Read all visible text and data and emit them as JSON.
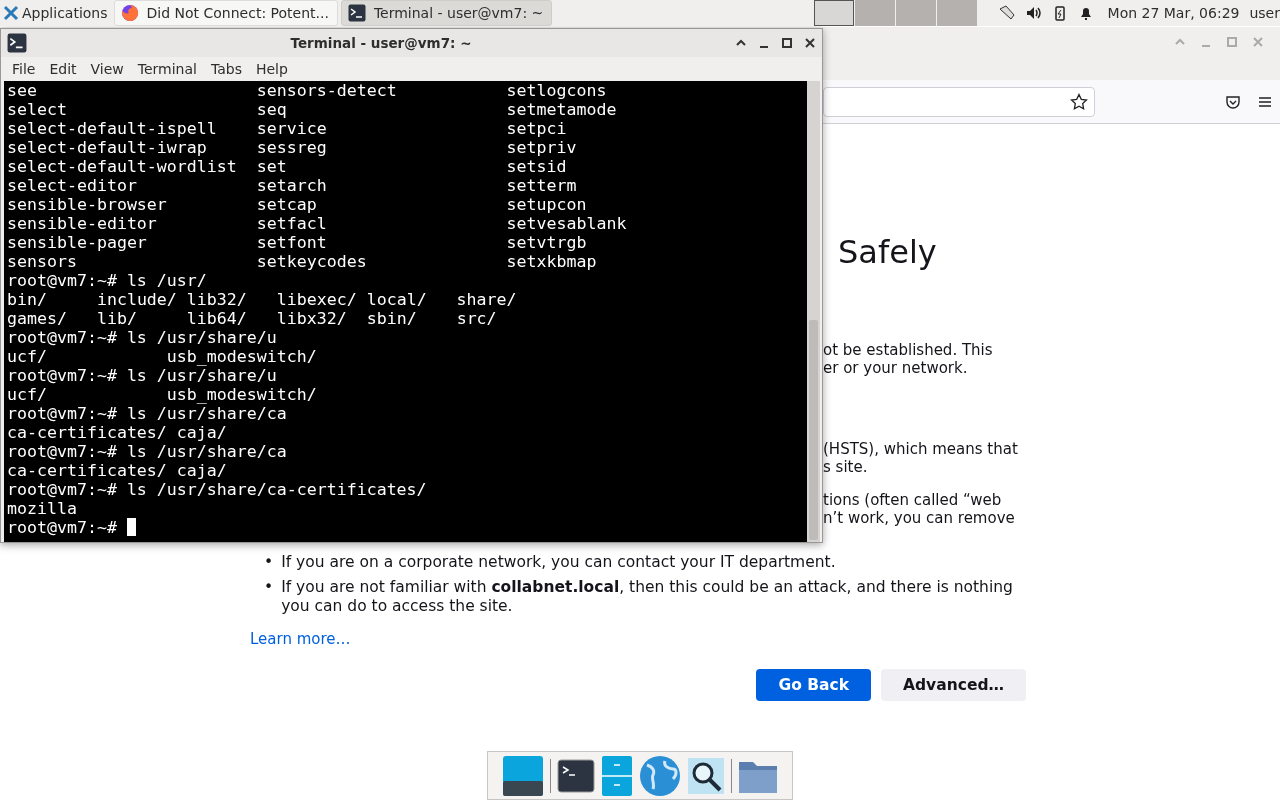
{
  "top_panel": {
    "menu": "Applications",
    "tasks": [
      {
        "title": "Did Not Connect: Potent...",
        "kind": "browser",
        "selected": false
      },
      {
        "title": "Terminal - user@vm7: ~",
        "kind": "terminal",
        "selected": true
      }
    ],
    "workspaces": [
      {
        "selected": true
      },
      {
        "selected": false
      },
      {
        "selected": false
      },
      {
        "selected": false
      }
    ],
    "clock": "Mon 27 Mar, 06:29",
    "user": "user"
  },
  "browser": {
    "heading": "Safely",
    "fragments": [
      [
        "ot be established. This",
        "er or your network."
      ],
      [
        "(HSTS), which means that",
        "s site."
      ],
      [
        "tions (often called “web",
        "n’t work, you can remove"
      ]
    ],
    "bullets": [
      {
        "marker": "•",
        "text": "If you are on a corporate network, you can contact your IT department."
      },
      {
        "marker": "•",
        "text": "If you are not familiar with **collabnet.local**, then this could be an attack, and there is nothing you can do to access the site."
      }
    ],
    "learn_more": "Learn more…",
    "buttons": [
      {
        "label": "Go Back",
        "kind": "primary"
      },
      {
        "label": "Advanced…",
        "kind": "secondary"
      }
    ]
  },
  "terminal": {
    "title": "Terminal - user@vm7: ~",
    "menu": [
      "File",
      "Edit",
      "View",
      "Terminal",
      "Tabs",
      "Help"
    ],
    "lines": [
      "see                      sensors-detect           setlogcons",
      "select                   seq                      setmetamode",
      "select-default-ispell    service                  setpci",
      "select-default-iwrap     sessreg                  setpriv",
      "select-default-wordlist  set                      setsid",
      "select-editor            setarch                  setterm",
      "sensible-browser         setcap                   setupcon",
      "sensible-editor          setfacl                  setvesablank",
      "sensible-pager           setfont                  setvtrgb",
      "sensors                  setkeycodes              setxkbmap",
      "root@vm7:~# ls /usr/",
      "bin/     include/ lib32/   libexec/ local/   share/",
      "games/   lib/     lib64/   libx32/  sbin/    src/",
      "root@vm7:~# ls /usr/share/u",
      "ucf/            usb_modeswitch/",
      "root@vm7:~# ls /usr/share/u",
      "ucf/            usb_modeswitch/",
      "root@vm7:~# ls /usr/share/ca",
      "ca-certificates/ caja/",
      "root@vm7:~# ls /usr/share/ca",
      "ca-certificates/ caja/",
      "root@vm7:~# ls /usr/share/ca-certificates/",
      "mozilla",
      "root@vm7:~# "
    ]
  },
  "dock": [
    {
      "kind": "desktop"
    },
    {
      "kind": "terminal"
    },
    {
      "kind": "cabinet"
    },
    {
      "kind": "globe"
    },
    {
      "kind": "search"
    },
    {
      "kind": "folder"
    }
  ]
}
